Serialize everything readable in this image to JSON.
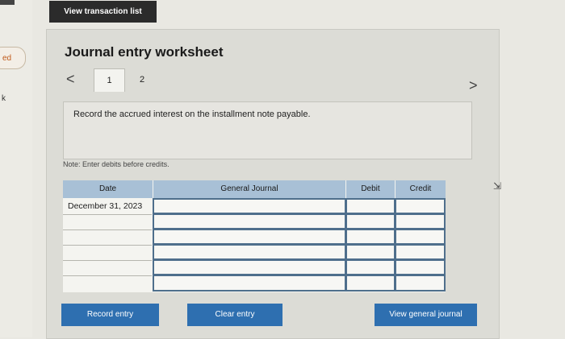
{
  "toolbar": {
    "view_transactions_label": "View transaction list"
  },
  "side": {
    "pill_text": "ed",
    "k_text": "k"
  },
  "worksheet": {
    "title": "Journal entry worksheet",
    "tabs": [
      "1",
      "2"
    ],
    "prev_arrow": "<",
    "next_arrow": ">",
    "instruction": "Record the accrued interest on the installment note payable.",
    "note": "Note: Enter debits before credits."
  },
  "table": {
    "columns": [
      "Date",
      "General Journal",
      "Debit",
      "Credit"
    ],
    "rows": [
      {
        "date": "December 31, 2023",
        "account": "",
        "debit": "",
        "credit": ""
      },
      {
        "date": "",
        "account": "",
        "debit": "",
        "credit": ""
      },
      {
        "date": "",
        "account": "",
        "debit": "",
        "credit": ""
      },
      {
        "date": "",
        "account": "",
        "debit": "",
        "credit": ""
      },
      {
        "date": "",
        "account": "",
        "debit": "",
        "credit": ""
      },
      {
        "date": "",
        "account": "",
        "debit": "",
        "credit": ""
      }
    ]
  },
  "buttons": {
    "record_entry": "Record entry",
    "clear_entry": "Clear entry",
    "view_general_journal": "View general journal"
  },
  "colors": {
    "accent": "#2e6fb0",
    "header": "#a8c0d6",
    "dark_button": "#2b2b2b"
  }
}
